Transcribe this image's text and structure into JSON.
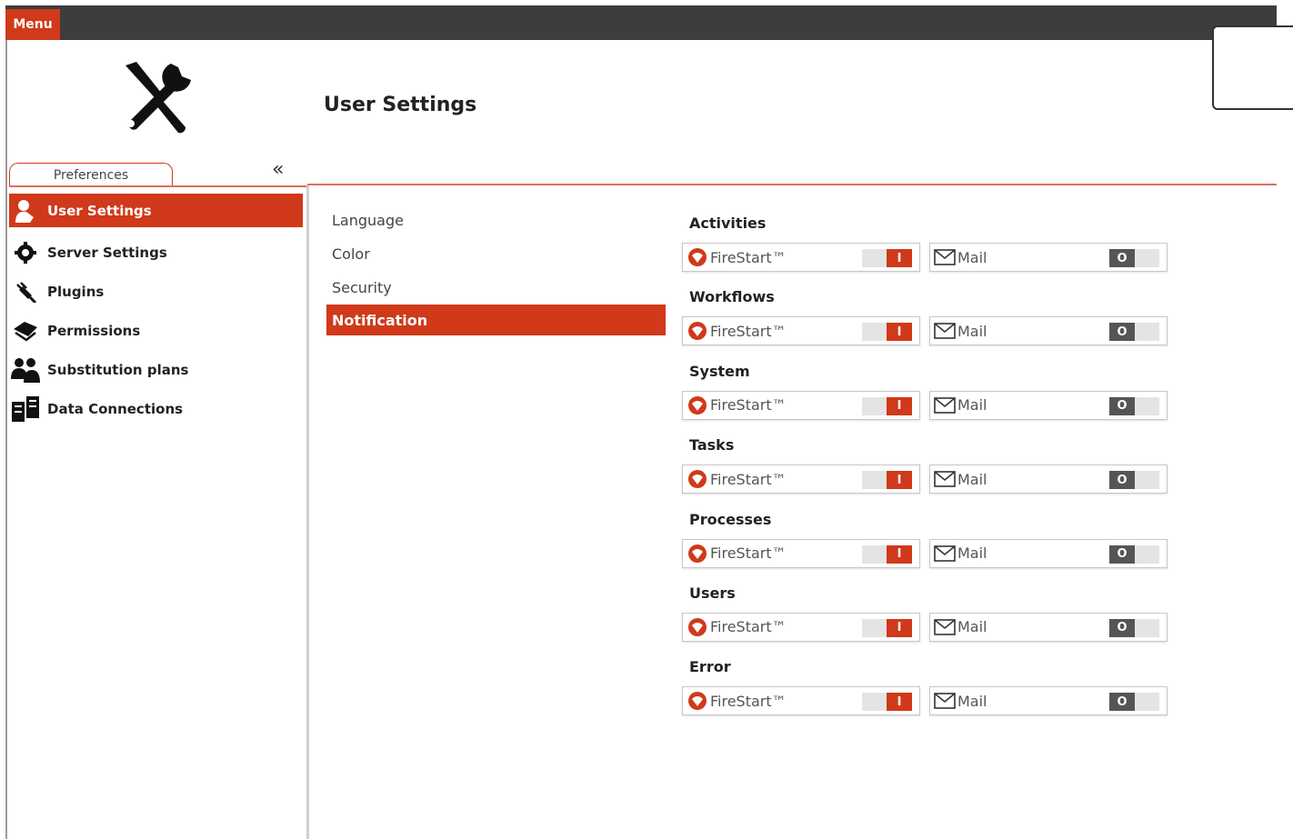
{
  "topbar": {
    "menu_label": "Menu"
  },
  "header": {
    "title": "User Settings"
  },
  "sidebar": {
    "tab_label": "Preferences",
    "collapse_symbol": "«",
    "items": [
      {
        "label": "User Settings",
        "icon": "user-icon",
        "active": true
      },
      {
        "label": "Server Settings",
        "icon": "gear-icon",
        "active": false
      },
      {
        "label": "Plugins",
        "icon": "plug-icon",
        "active": false
      },
      {
        "label": "Permissions",
        "icon": "permissions-icon",
        "active": false
      },
      {
        "label": "Substitution plans",
        "icon": "users-icon",
        "active": false
      },
      {
        "label": "Data Connections",
        "icon": "database-icon",
        "active": false
      }
    ]
  },
  "subnav": {
    "items": [
      {
        "label": "Language",
        "active": false
      },
      {
        "label": "Color",
        "active": false
      },
      {
        "label": "Security",
        "active": false
      },
      {
        "label": "Notification",
        "active": true
      }
    ]
  },
  "notifications": {
    "firestart_label": "FireStart™",
    "mail_label": "Mail",
    "on_symbol": "I",
    "off_symbol": "O",
    "groups": [
      {
        "title": "Activities",
        "firestart_on": true,
        "mail_on": false
      },
      {
        "title": "Workflows",
        "firestart_on": true,
        "mail_on": false
      },
      {
        "title": "System",
        "firestart_on": true,
        "mail_on": false
      },
      {
        "title": "Tasks",
        "firestart_on": true,
        "mail_on": false
      },
      {
        "title": "Processes",
        "firestart_on": true,
        "mail_on": false
      },
      {
        "title": "Users",
        "firestart_on": true,
        "mail_on": false
      },
      {
        "title": "Error",
        "firestart_on": true,
        "mail_on": false
      }
    ]
  },
  "colors": {
    "accent": "#d0391a",
    "topbar": "#3d3d3d",
    "toggle_off": "#555555"
  }
}
